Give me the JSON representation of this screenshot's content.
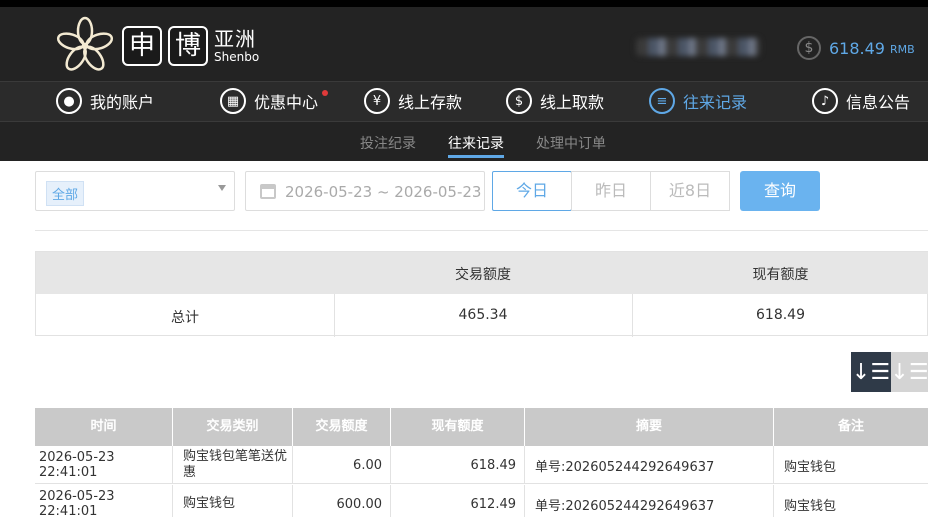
{
  "brand": {
    "logo_box_1": "申",
    "logo_box_2": "博",
    "name_cn": "亚洲",
    "name_en": "Shenbo"
  },
  "account": {
    "currency_symbol": "$",
    "balance": "618.49",
    "unit": "RMB"
  },
  "nav": {
    "items": [
      {
        "label": "我的账户",
        "icon": "user-icon"
      },
      {
        "label": "优惠中心",
        "icon": "gift-icon",
        "has_dot": true
      },
      {
        "label": "线上存款",
        "icon": "deposit-icon"
      },
      {
        "label": "线上取款",
        "icon": "withdraw-icon"
      },
      {
        "label": "往来记录",
        "icon": "records-icon",
        "active": true
      },
      {
        "label": "信息公告",
        "icon": "bell-icon"
      }
    ],
    "accent_color": "#5fa8e6"
  },
  "subnav": {
    "items": [
      {
        "label": "投注纪录"
      },
      {
        "label": "往来记录",
        "active": true
      },
      {
        "label": "处理中订单"
      }
    ]
  },
  "filters": {
    "type_selected": "全部",
    "date_range": "2026-05-23 ~ 2026-05-23",
    "range_buttons": [
      "今日",
      "昨日",
      "近8日"
    ],
    "query_label": "查询"
  },
  "summary": {
    "headers": [
      "",
      "交易额度",
      "现有额度"
    ],
    "row": {
      "label": "总计",
      "amount": "465.34",
      "balance": "618.49"
    }
  },
  "table": {
    "columns": [
      "时间",
      "交易类别",
      "交易额度",
      "现有额度",
      "摘要",
      "备注"
    ],
    "rows": [
      {
        "time": "2026-05-23 22:41:01",
        "category": "购宝钱包笔笔送优惠",
        "amount": "6.00",
        "balance": "618.49",
        "memo": "单号:202605244292649637",
        "note": "购宝钱包"
      },
      {
        "time": "2026-05-23 22:41:01",
        "category": "购宝钱包",
        "amount": "600.00",
        "balance": "612.49",
        "memo": "单号:202605244292649637",
        "note": "购宝钱包"
      }
    ]
  }
}
